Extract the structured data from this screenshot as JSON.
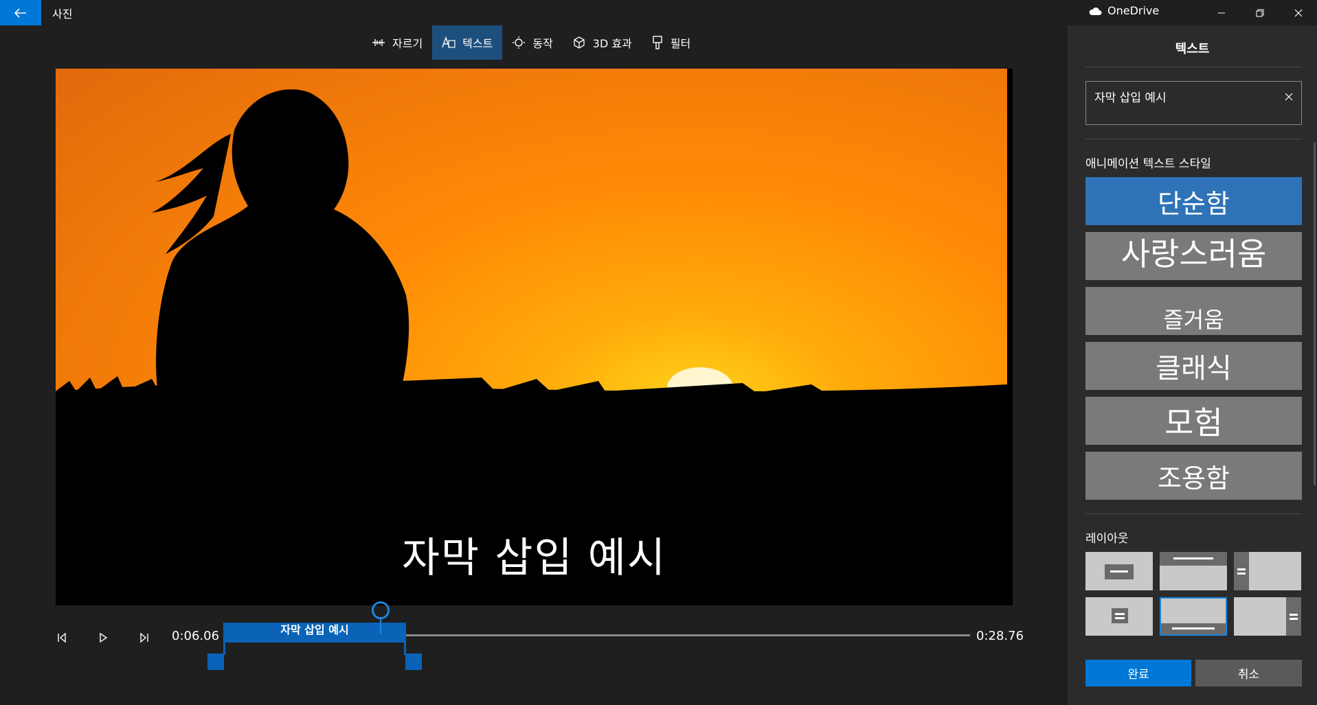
{
  "titlebar": {
    "app_title": "사진",
    "onedrive_label": "OneDrive"
  },
  "toolbar": {
    "items": [
      {
        "label": "자르기",
        "icon": "trim-icon"
      },
      {
        "label": "텍스트",
        "icon": "text-icon"
      },
      {
        "label": "동작",
        "icon": "motion-icon"
      },
      {
        "label": "3D 효과",
        "icon": "3d-effects-icon"
      },
      {
        "label": "필터",
        "icon": "filter-icon"
      }
    ],
    "active": "텍스트"
  },
  "preview": {
    "caption": "자막 삽입 예시"
  },
  "timeline": {
    "current_time": "0:06.06",
    "total_time": "0:28.76",
    "clip_label": "자막 삽입 예시"
  },
  "panel": {
    "title": "텍스트",
    "text_value": "자막 삽입 예시",
    "style_section_label": "애니메이션 텍스트 스타일",
    "styles": [
      "단순함",
      "사랑스러움",
      "즐거움",
      "클래식",
      "모험",
      "조용함"
    ],
    "selected_style": "단순함",
    "layout_section_label": "레이아웃",
    "selected_layout": 5,
    "done_label": "완료",
    "cancel_label": "취소"
  },
  "colors": {
    "accent": "#0078d7",
    "selected_style": "#2e73b8",
    "style_button": "#7a7a7a",
    "clip": "#0a63b6"
  }
}
